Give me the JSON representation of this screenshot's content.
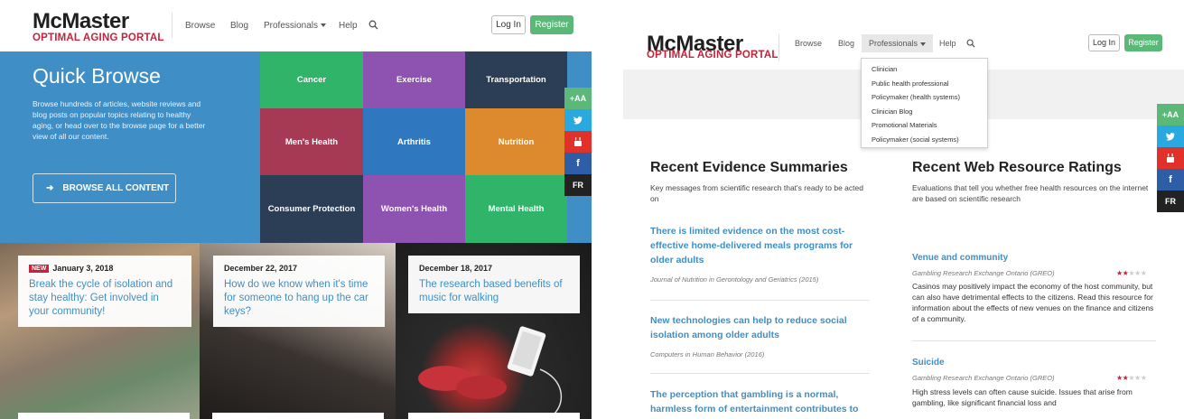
{
  "left": {
    "logo": {
      "main": "McMaster",
      "sub": "OPTIMAL AGING PORTAL"
    },
    "nav": {
      "browse": "Browse",
      "blog": "Blog",
      "professionals": "Professionals",
      "help": "Help"
    },
    "buttons": {
      "login": "Log In",
      "register": "Register"
    },
    "quick_browse": {
      "title": "Quick Browse",
      "text": "Browse hundreds of articles, website reviews and blog posts on popular topics relating to healthy aging, or head over to the browse page for a better view of all our content.",
      "button": "BROWSE ALL CONTENT"
    },
    "tiles": [
      {
        "label": "Cancer",
        "color": "#2fb46a"
      },
      {
        "label": "Exercise",
        "color": "#8e52b0"
      },
      {
        "label": "Transportation",
        "color": "#2c3e55"
      },
      {
        "label": "Men's Health",
        "color": "#a63a55"
      },
      {
        "label": "Arthritis",
        "color": "#2f78c0"
      },
      {
        "label": "Nutrition",
        "color": "#dd8a2e"
      },
      {
        "label": "Consumer Protection",
        "color": "#2c3e55"
      },
      {
        "label": "Women's Health",
        "color": "#8e52b0"
      },
      {
        "label": "Mental Health",
        "color": "#2fb46a"
      }
    ],
    "side": {
      "text_size": "+AA",
      "lang": "FR"
    },
    "articles": [
      {
        "badge": "NEW",
        "date": "January 3, 2018",
        "title": "Break the cycle of isolation and stay healthy: Get involved in your community!"
      },
      {
        "date": "December 22, 2017",
        "title": "How do we know when it's time for someone to hang up the car keys?"
      },
      {
        "date": "December 18, 2017",
        "title": "The research based benefits of music for walking"
      }
    ]
  },
  "right": {
    "logo": {
      "main": "McMaster",
      "sub": "OPTIMAL AGING PORTAL"
    },
    "nav": {
      "browse": "Browse",
      "blog": "Blog",
      "professionals": "Professionals",
      "help": "Help"
    },
    "buttons": {
      "login": "Log In",
      "register": "Register"
    },
    "dropdown": [
      "Clinician",
      "Public health professional",
      "Policymaker (health systems)",
      "Clinician Blog",
      "Promotional Materials",
      "Policymaker (social systems)"
    ],
    "side": {
      "text_size": "+AA",
      "lang": "FR"
    },
    "evidence": {
      "title": "Recent Evidence Summaries",
      "subtitle": "Key messages from scientific research that's ready to be acted on",
      "items": [
        {
          "title": "There is limited evidence on the most cost-effective home-delivered meals programs for older adults",
          "source": "Journal of Nutrition in Gerontology and Geriatrics (2015)"
        },
        {
          "title": "New technologies can help to reduce social isolation among older adults",
          "source": "Computers in Human Behavior (2016)"
        },
        {
          "title": "The perception that gambling is a normal, harmless form of entertainment contributes to",
          "source": ""
        }
      ]
    },
    "web": {
      "title": "Recent Web Resource Ratings",
      "subtitle": "Evaluations that tell you whether free health resources on the internet are based on scientific research",
      "items": [
        {
          "title": "Venue and community",
          "source": "Gambling Research Exchange Ontario (GREO)",
          "rating": 2,
          "rating_max": 5,
          "body": "Casinos may positively impact the economy of the host community, but can also have detrimental effects to the citizens. Read this resource for information about the effects of new venues on the finance and citizens of a community."
        },
        {
          "title": "Suicide",
          "source": "Gambling Research Exchange Ontario (GREO)",
          "rating": 2,
          "rating_max": 5,
          "body": "High stress levels can often cause suicide. Issues that arise from gambling, like significant financial loss and"
        }
      ]
    }
  }
}
